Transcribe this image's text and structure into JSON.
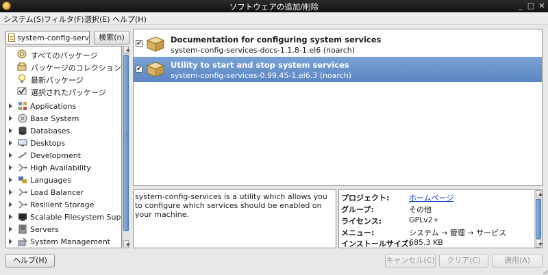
{
  "window": {
    "title": "ソフトウェアの追加/削除",
    "controls": [
      "_",
      "□",
      "✕"
    ]
  },
  "menubar": [
    "システム(S)",
    "フィルタ(F)",
    "選択(E)",
    "ヘルプ(H)"
  ],
  "search": {
    "value": "system-config-services",
    "button_label": "検索(n)"
  },
  "tree": {
    "special_items": [
      {
        "label": "すべてのパッケージ",
        "icon": "all-packages-icon"
      },
      {
        "label": "パッケージのコレクション",
        "icon": "collections-icon"
      },
      {
        "label": "最新パッケージ",
        "icon": "lightbulb-icon"
      },
      {
        "label": "選択されたパッケージ",
        "icon": "selected-packages-icon"
      }
    ],
    "groups": [
      {
        "label": "Applications",
        "icon": "applications-icon"
      },
      {
        "label": "Base System",
        "icon": "base-system-icon"
      },
      {
        "label": "Databases",
        "icon": "database-icon"
      },
      {
        "label": "Desktops",
        "icon": "desktop-icon"
      },
      {
        "label": "Development",
        "icon": "development-icon"
      },
      {
        "label": "High Availability",
        "icon": "network-icon"
      },
      {
        "label": "Languages",
        "icon": "languages-icon"
      },
      {
        "label": "Load Balancer",
        "icon": "network-icon"
      },
      {
        "label": "Resilient Storage",
        "icon": "network-icon"
      },
      {
        "label": "Scalable Filesystem Support",
        "icon": "filesystem-icon"
      },
      {
        "label": "Servers",
        "icon": "servers-icon"
      },
      {
        "label": "System Management",
        "icon": "system-management-icon"
      }
    ]
  },
  "packages": [
    {
      "name": "Documentation for configuring system services",
      "version": "system-config-services-docs-1.1.8-1.el6 (noarch)",
      "checked": true,
      "selected": false
    },
    {
      "name": "Utility to start and stop system services",
      "version": "system-config-services-0.99.45-1.el6.3 (noarch)",
      "checked": true,
      "selected": true
    }
  ],
  "description": "system-config-services is a utility which allows you to configure which services should be enabled on your machine.",
  "details": [
    {
      "key": "プロジェクト:",
      "value": "ホームページ",
      "link": true
    },
    {
      "key": "グループ:",
      "value": "その他",
      "link": false
    },
    {
      "key": "ライセンス:",
      "value": "GPLv2+",
      "link": false
    },
    {
      "key": "メニュー:",
      "value": "システム → 管理 → サービス",
      "link": false
    },
    {
      "key": "インストールサイズ:",
      "value": "685.3 KB",
      "link": false
    }
  ],
  "buttons": {
    "help": "ヘルプ(H)",
    "cancel": "キャンセル(C)",
    "clear": "クリア(C)",
    "apply": "適用(A)"
  },
  "colors": {
    "selection": "#5b86c2",
    "titlebar": "#111111",
    "link": "#1a3fbf"
  }
}
